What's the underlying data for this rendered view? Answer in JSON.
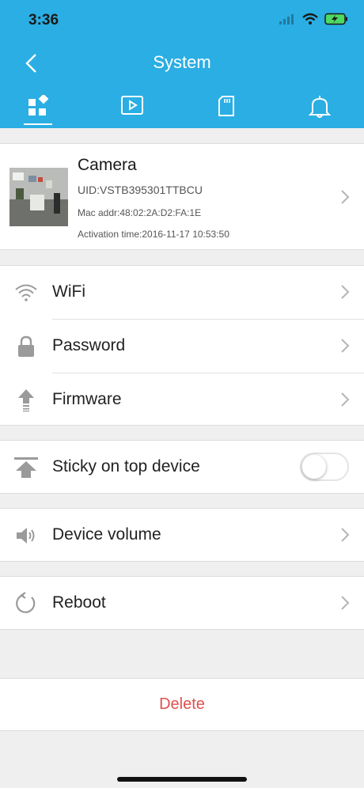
{
  "status_bar": {
    "time": "3:36"
  },
  "nav": {
    "title": "System"
  },
  "tabs": [
    {
      "icon": "dashboard-icon"
    },
    {
      "icon": "video-playback-icon"
    },
    {
      "icon": "sd-card-icon"
    },
    {
      "icon": "bell-icon"
    }
  ],
  "camera": {
    "name": "Camera",
    "uid": "UID:VSTB395301TTBCU",
    "mac": "Mac addr:48:02:2A:D2:FA:1E",
    "activation": "Activation time:2016-11-17 10:53:50"
  },
  "settings": {
    "wifi": "WiFi",
    "password": "Password",
    "firmware": "Firmware",
    "sticky": "Sticky on top device",
    "sticky_on": false,
    "volume": "Device volume",
    "reboot": "Reboot"
  },
  "delete_label": "Delete",
  "colors": {
    "accent": "#2aaee3",
    "danger": "#e0504c"
  }
}
